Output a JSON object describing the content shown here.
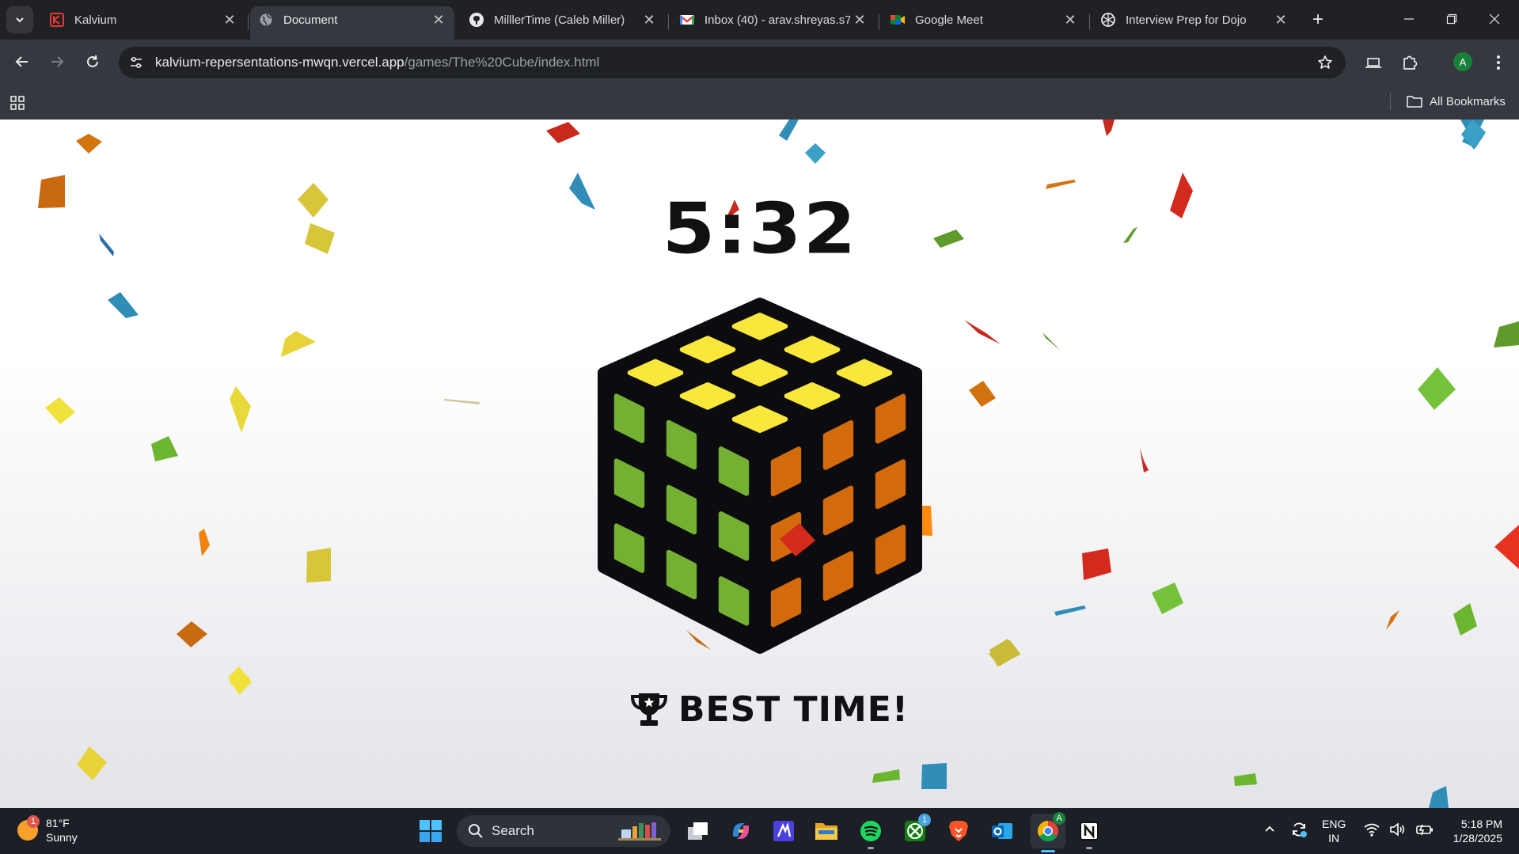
{
  "browser": {
    "tabs": [
      {
        "label": "Kalvium",
        "icon": "kalvium-logo-icon",
        "active": false
      },
      {
        "label": "Document",
        "icon": "globe-icon",
        "active": true
      },
      {
        "label": "MilllerTime (Caleb Miller)",
        "icon": "github-icon",
        "active": false
      },
      {
        "label": "Inbox (40) - arav.shreyas.s7",
        "icon": "gmail-icon",
        "active": false
      },
      {
        "label": "Google Meet",
        "icon": "google-meet-icon",
        "active": false
      },
      {
        "label": "Interview Prep for Dojo",
        "icon": "chatgpt-icon",
        "active": false
      }
    ],
    "address": {
      "host": "kalvium-repersentations-mwqn.vercel.app",
      "path": "/games/The%20Cube/index.html"
    },
    "profile_initial": "A",
    "bookmarks": {
      "all_bookmarks_label": "All Bookmarks"
    }
  },
  "game": {
    "timer": "5:32",
    "result": "BEST TIME!",
    "cube_colors": {
      "top": "#fae73c",
      "left": "#74b133",
      "right": "#d36b0d",
      "body": "#0c0c10"
    }
  },
  "taskbar": {
    "weather": {
      "temp": "81°F",
      "condition": "Sunny",
      "badge": "1"
    },
    "search_label": "Search",
    "pinned": [
      "task-view",
      "copilot",
      "vs-code",
      "file-explorer",
      "spotify",
      "xbox",
      "brave",
      "outlook",
      "chrome",
      "notion"
    ],
    "xbox_badge": "1",
    "language": {
      "line1": "ENG",
      "line2": "IN"
    },
    "time": "5:18 PM",
    "date": "1/28/2025"
  }
}
